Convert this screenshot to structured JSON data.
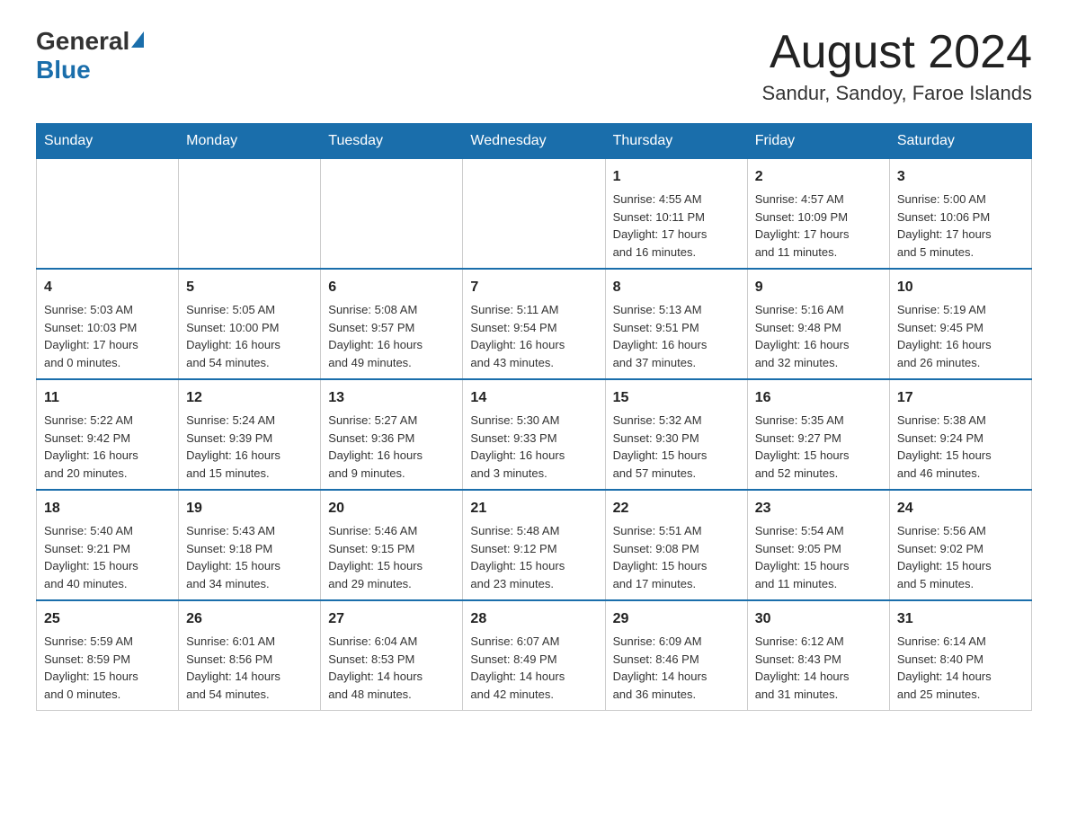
{
  "header": {
    "logo_general": "General",
    "logo_blue": "Blue",
    "month_title": "August 2024",
    "location": "Sandur, Sandoy, Faroe Islands"
  },
  "days_of_week": [
    "Sunday",
    "Monday",
    "Tuesday",
    "Wednesday",
    "Thursday",
    "Friday",
    "Saturday"
  ],
  "weeks": [
    [
      {
        "day": "",
        "info": ""
      },
      {
        "day": "",
        "info": ""
      },
      {
        "day": "",
        "info": ""
      },
      {
        "day": "",
        "info": ""
      },
      {
        "day": "1",
        "info": "Sunrise: 4:55 AM\nSunset: 10:11 PM\nDaylight: 17 hours\nand 16 minutes."
      },
      {
        "day": "2",
        "info": "Sunrise: 4:57 AM\nSunset: 10:09 PM\nDaylight: 17 hours\nand 11 minutes."
      },
      {
        "day": "3",
        "info": "Sunrise: 5:00 AM\nSunset: 10:06 PM\nDaylight: 17 hours\nand 5 minutes."
      }
    ],
    [
      {
        "day": "4",
        "info": "Sunrise: 5:03 AM\nSunset: 10:03 PM\nDaylight: 17 hours\nand 0 minutes."
      },
      {
        "day": "5",
        "info": "Sunrise: 5:05 AM\nSunset: 10:00 PM\nDaylight: 16 hours\nand 54 minutes."
      },
      {
        "day": "6",
        "info": "Sunrise: 5:08 AM\nSunset: 9:57 PM\nDaylight: 16 hours\nand 49 minutes."
      },
      {
        "day": "7",
        "info": "Sunrise: 5:11 AM\nSunset: 9:54 PM\nDaylight: 16 hours\nand 43 minutes."
      },
      {
        "day": "8",
        "info": "Sunrise: 5:13 AM\nSunset: 9:51 PM\nDaylight: 16 hours\nand 37 minutes."
      },
      {
        "day": "9",
        "info": "Sunrise: 5:16 AM\nSunset: 9:48 PM\nDaylight: 16 hours\nand 32 minutes."
      },
      {
        "day": "10",
        "info": "Sunrise: 5:19 AM\nSunset: 9:45 PM\nDaylight: 16 hours\nand 26 minutes."
      }
    ],
    [
      {
        "day": "11",
        "info": "Sunrise: 5:22 AM\nSunset: 9:42 PM\nDaylight: 16 hours\nand 20 minutes."
      },
      {
        "day": "12",
        "info": "Sunrise: 5:24 AM\nSunset: 9:39 PM\nDaylight: 16 hours\nand 15 minutes."
      },
      {
        "day": "13",
        "info": "Sunrise: 5:27 AM\nSunset: 9:36 PM\nDaylight: 16 hours\nand 9 minutes."
      },
      {
        "day": "14",
        "info": "Sunrise: 5:30 AM\nSunset: 9:33 PM\nDaylight: 16 hours\nand 3 minutes."
      },
      {
        "day": "15",
        "info": "Sunrise: 5:32 AM\nSunset: 9:30 PM\nDaylight: 15 hours\nand 57 minutes."
      },
      {
        "day": "16",
        "info": "Sunrise: 5:35 AM\nSunset: 9:27 PM\nDaylight: 15 hours\nand 52 minutes."
      },
      {
        "day": "17",
        "info": "Sunrise: 5:38 AM\nSunset: 9:24 PM\nDaylight: 15 hours\nand 46 minutes."
      }
    ],
    [
      {
        "day": "18",
        "info": "Sunrise: 5:40 AM\nSunset: 9:21 PM\nDaylight: 15 hours\nand 40 minutes."
      },
      {
        "day": "19",
        "info": "Sunrise: 5:43 AM\nSunset: 9:18 PM\nDaylight: 15 hours\nand 34 minutes."
      },
      {
        "day": "20",
        "info": "Sunrise: 5:46 AM\nSunset: 9:15 PM\nDaylight: 15 hours\nand 29 minutes."
      },
      {
        "day": "21",
        "info": "Sunrise: 5:48 AM\nSunset: 9:12 PM\nDaylight: 15 hours\nand 23 minutes."
      },
      {
        "day": "22",
        "info": "Sunrise: 5:51 AM\nSunset: 9:08 PM\nDaylight: 15 hours\nand 17 minutes."
      },
      {
        "day": "23",
        "info": "Sunrise: 5:54 AM\nSunset: 9:05 PM\nDaylight: 15 hours\nand 11 minutes."
      },
      {
        "day": "24",
        "info": "Sunrise: 5:56 AM\nSunset: 9:02 PM\nDaylight: 15 hours\nand 5 minutes."
      }
    ],
    [
      {
        "day": "25",
        "info": "Sunrise: 5:59 AM\nSunset: 8:59 PM\nDaylight: 15 hours\nand 0 minutes."
      },
      {
        "day": "26",
        "info": "Sunrise: 6:01 AM\nSunset: 8:56 PM\nDaylight: 14 hours\nand 54 minutes."
      },
      {
        "day": "27",
        "info": "Sunrise: 6:04 AM\nSunset: 8:53 PM\nDaylight: 14 hours\nand 48 minutes."
      },
      {
        "day": "28",
        "info": "Sunrise: 6:07 AM\nSunset: 8:49 PM\nDaylight: 14 hours\nand 42 minutes."
      },
      {
        "day": "29",
        "info": "Sunrise: 6:09 AM\nSunset: 8:46 PM\nDaylight: 14 hours\nand 36 minutes."
      },
      {
        "day": "30",
        "info": "Sunrise: 6:12 AM\nSunset: 8:43 PM\nDaylight: 14 hours\nand 31 minutes."
      },
      {
        "day": "31",
        "info": "Sunrise: 6:14 AM\nSunset: 8:40 PM\nDaylight: 14 hours\nand 25 minutes."
      }
    ]
  ]
}
